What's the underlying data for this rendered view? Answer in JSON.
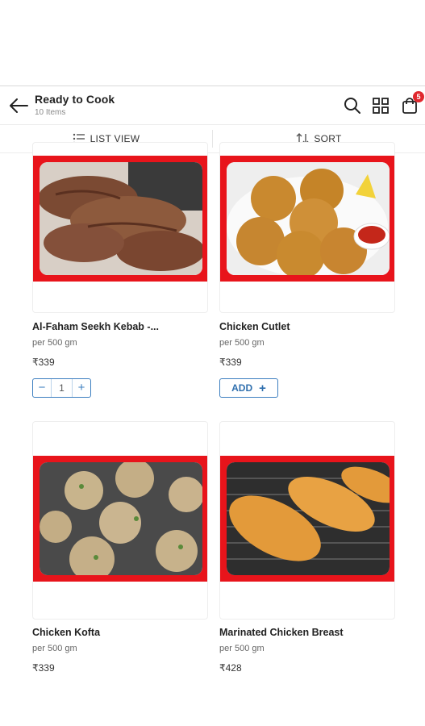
{
  "header": {
    "title": "Ready to Cook",
    "subtitle": "10 Items",
    "cart_count": "5"
  },
  "toolbar": {
    "list_view_label": "LIST VIEW",
    "sort_label": "SORT"
  },
  "products": [
    {
      "name": "Al-Faham Seekh Kebab -...",
      "weight": "per 500 gm",
      "price": "₹339",
      "qty": "1"
    },
    {
      "name": "Chicken Cutlet",
      "weight": "per 500 gm",
      "price": "₹339",
      "add_label": "ADD"
    },
    {
      "name": "Chicken Kofta",
      "weight": "per 500 gm",
      "price": "₹339"
    },
    {
      "name": "Marinated Chicken Breast",
      "weight": "per 500 gm",
      "price": "₹428"
    }
  ],
  "colors": {
    "accent_red": "#e8141b",
    "accent_blue": "#3d7fc0",
    "badge_red": "#e0282e"
  }
}
